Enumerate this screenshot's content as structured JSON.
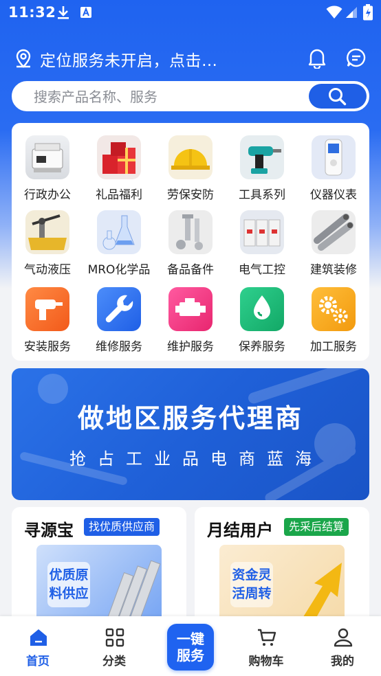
{
  "status": {
    "time": "11:32"
  },
  "header": {
    "location_text": "定位服务未开启，点击…"
  },
  "search": {
    "placeholder": "搜索产品名称、服务"
  },
  "categories": [
    {
      "label": "行政办公",
      "icon": "printer-icon"
    },
    {
      "label": "礼品福利",
      "icon": "gift-icon"
    },
    {
      "label": "劳保安防",
      "icon": "helmet-icon"
    },
    {
      "label": "工具系列",
      "icon": "drill-icon"
    },
    {
      "label": "仪器仪表",
      "icon": "meter-icon"
    },
    {
      "label": "气动液压",
      "icon": "pump-icon"
    },
    {
      "label": "MRO化学品",
      "icon": "flask-icon"
    },
    {
      "label": "备品备件",
      "icon": "bolt-icon"
    },
    {
      "label": "电气工控",
      "icon": "breaker-icon"
    },
    {
      "label": "建筑装修",
      "icon": "pipe-icon"
    },
    {
      "label": "安装服务",
      "icon": "drill-service-icon"
    },
    {
      "label": "维修服务",
      "icon": "wrench-icon"
    },
    {
      "label": "维护服务",
      "icon": "engine-icon"
    },
    {
      "label": "保养服务",
      "icon": "drop-icon"
    },
    {
      "label": "加工服务",
      "icon": "gears-icon"
    }
  ],
  "banner": {
    "title": "做地区服务代理商",
    "subtitle": "抢占工业品电商蓝海"
  },
  "promos": [
    {
      "title": "寻源宝",
      "tag": "找优质供应商",
      "tag_color": "#1f5fe6",
      "image_text": "优质原料供应"
    },
    {
      "title": "月结用户",
      "tag": "先采后结算",
      "tag_color": "#1aa64a",
      "image_text": "资金灵活周转"
    }
  ],
  "tabbar": {
    "home": "首页",
    "category": "分类",
    "center_line1": "一键",
    "center_line2": "服务",
    "cart": "购物车",
    "mine": "我的"
  },
  "colors": {
    "brand": "#1f63f0",
    "green_tag": "#1aa64a"
  }
}
